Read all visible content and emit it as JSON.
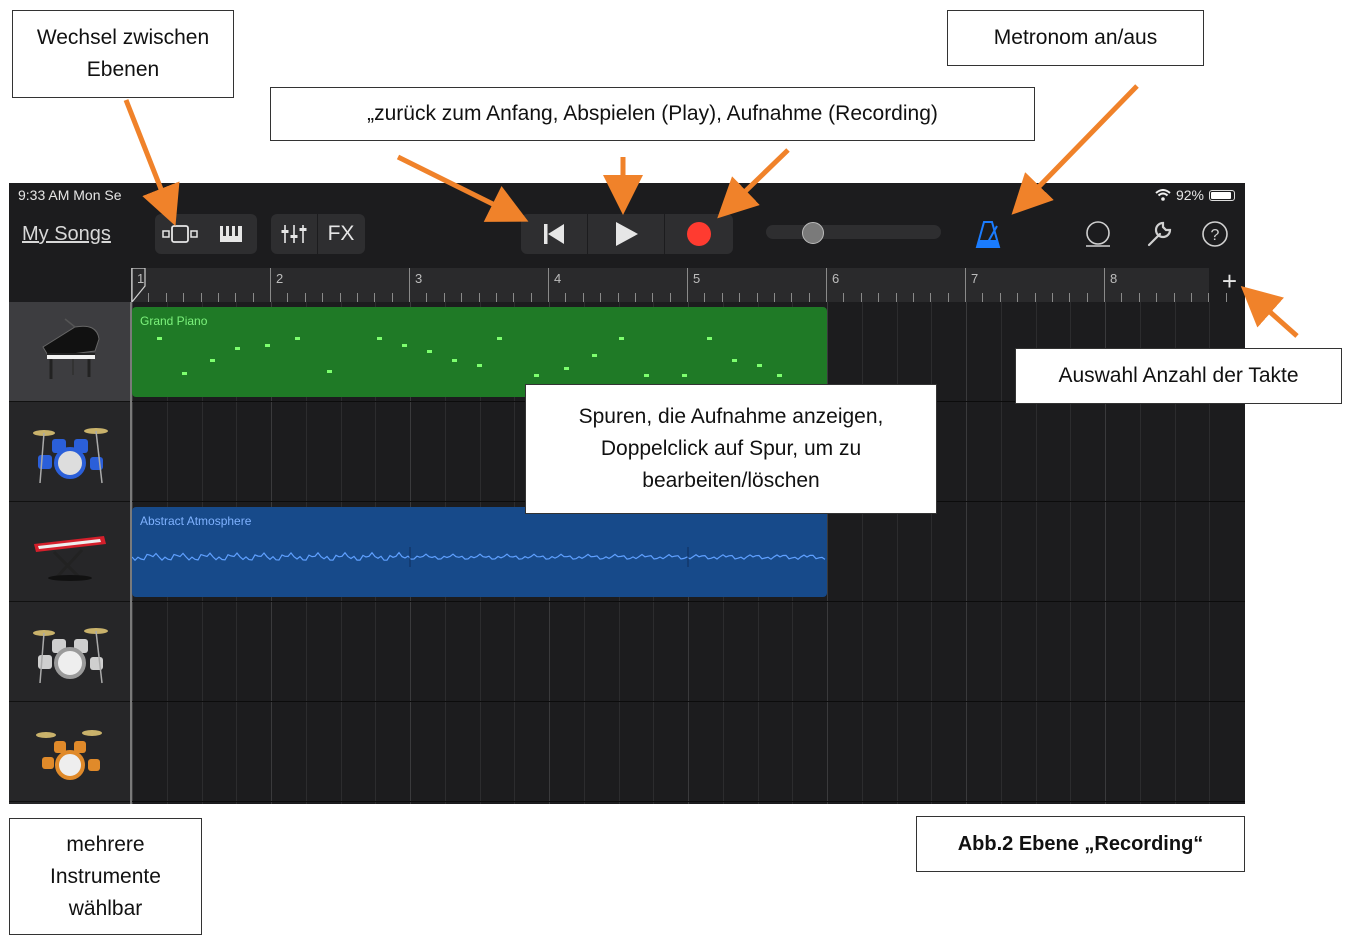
{
  "callouts": {
    "layers": [
      "Wechsel zwischen",
      "Ebenen"
    ],
    "transport": "„zurück zum Anfang, Abspielen (Play), Aufnahme (Recording)",
    "metronome": "Metronom an/aus",
    "bars_count": "Auswahl Anzahl der Takte",
    "tracks_info": [
      "Spuren, die Aufnahme anzeigen,",
      "Doppelclick auf Spur, um zu",
      "bearbeiten/löschen"
    ],
    "instruments": [
      "mehrere",
      "Instrumente",
      "wählbar"
    ],
    "caption": "Abb.2 Ebene „Recording“"
  },
  "statusbar": {
    "time": "9:33 AM   Mon Se",
    "battery": "92%"
  },
  "toolbar": {
    "my_songs": "My Songs",
    "fx": "FX",
    "icons": [
      "tracks-view-icon",
      "keyboard-icon",
      "mixer-icon",
      "go-to-beginning-icon",
      "play-icon",
      "record-icon",
      "metronome-icon",
      "loop-icon",
      "settings-wrench-icon",
      "help-icon"
    ],
    "accent_blue": "#1a7cff",
    "record_red": "#ff3b30",
    "help": "?"
  },
  "ruler": {
    "bars": [
      "1",
      "2",
      "3",
      "4",
      "5",
      "6",
      "7",
      "8"
    ],
    "add": "+"
  },
  "tracks": [
    {
      "instrument": "grand-piano",
      "selected": true
    },
    {
      "instrument": "drum-kit-blue",
      "selected": false
    },
    {
      "instrument": "synth-keyboard-red",
      "selected": false
    },
    {
      "instrument": "drum-kit-silver",
      "selected": false
    },
    {
      "instrument": "drum-kit-orange",
      "selected": false
    }
  ],
  "regions": [
    {
      "name": "Grand Piano",
      "track": 0,
      "color": "#1f7a26"
    },
    {
      "name": "Abstract Atmosphere",
      "track": 2,
      "color": "#174a8a"
    }
  ]
}
